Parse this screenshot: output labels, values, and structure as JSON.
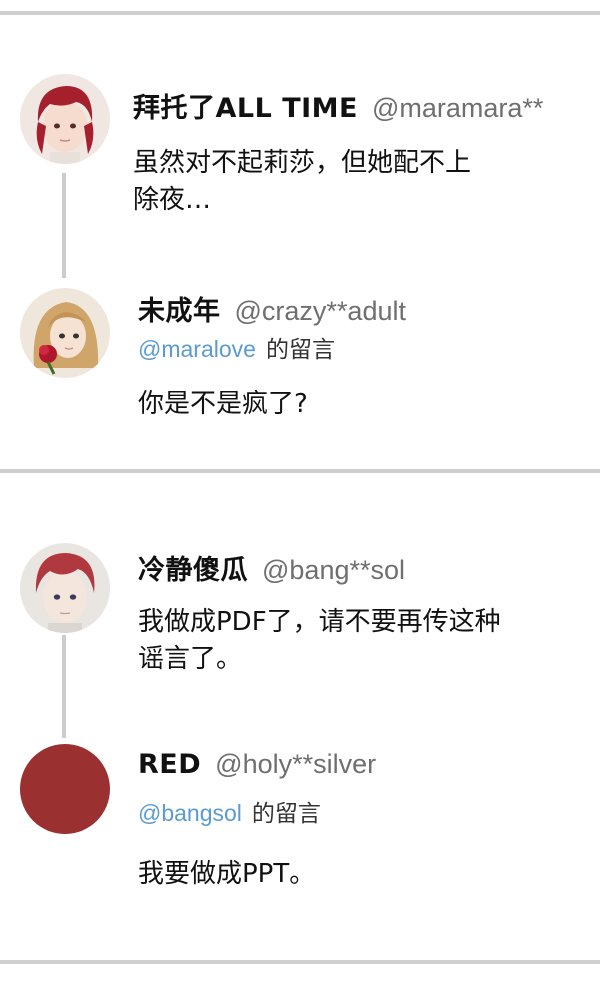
{
  "threads": [
    {
      "post": {
        "username": "拜托了ALL TIME",
        "handle": "@maramara**",
        "text": "虽然对不起莉莎，但她配不上除夜…",
        "text_line1": "虽然对不起莉莎，但她配不上",
        "text_line2": "除夜…",
        "avatar_icon": "red-haired-character-avatar"
      },
      "reply": {
        "username": "未成年",
        "handle": "@crazy**adult",
        "reply_to": "@maralove",
        "reply_suffix": "的留言",
        "text": "你是不是疯了?",
        "avatar_icon": "blonde-character-with-rose-avatar"
      }
    },
    {
      "post": {
        "username": "冷静傻瓜",
        "handle": "@bang**sol",
        "text_line1": "我做成PDF了，请不要再传这种",
        "text_line2": "谣言了。",
        "avatar_icon": "red-haired-boy-avatar"
      },
      "reply": {
        "username": "RED",
        "handle": "@holy**silver",
        "reply_to": "@bangsol",
        "reply_suffix": "的留言",
        "text": "我要做成PPT。",
        "avatar_icon": "solid-red-circle-avatar",
        "avatar_color": "#9a3030"
      }
    }
  ],
  "colors": {
    "divider": "#cfcfcf",
    "thread_line": "#cccccc",
    "mention": "#5b9bd0",
    "handle": "#6f6f6f"
  }
}
